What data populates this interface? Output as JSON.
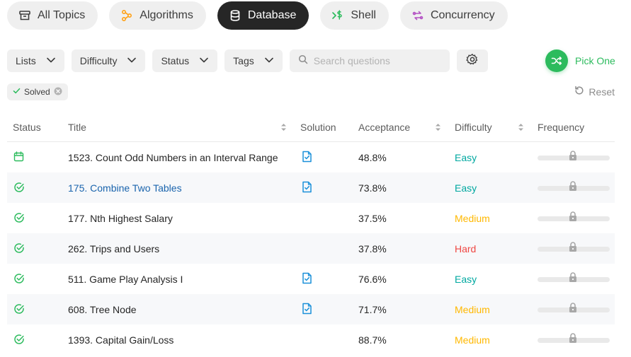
{
  "topics": [
    {
      "label": "All Topics",
      "icon": "archive-icon",
      "active": false
    },
    {
      "label": "Algorithms",
      "icon": "algorithms-icon",
      "active": false
    },
    {
      "label": "Database",
      "icon": "database-icon",
      "active": true
    },
    {
      "label": "Shell",
      "icon": "shell-icon",
      "active": false
    },
    {
      "label": "Concurrency",
      "icon": "concurrency-icon",
      "active": false
    }
  ],
  "filters": {
    "lists": "Lists",
    "difficulty": "Difficulty",
    "status": "Status",
    "tags": "Tags",
    "search_placeholder": "Search questions"
  },
  "pick_one": "Pick One",
  "active_tag": "Solved",
  "reset": "Reset",
  "columns": {
    "status": "Status",
    "title": "Title",
    "solution": "Solution",
    "acceptance": "Acceptance",
    "difficulty": "Difficulty",
    "frequency": "Frequency"
  },
  "rows": [
    {
      "status": "calendar-icon",
      "title": "1523. Count Odd Numbers in an Interval Range",
      "solution": true,
      "acceptance": "48.8%",
      "difficulty": "Easy"
    },
    {
      "status": "check-icon",
      "title": "175. Combine Two Tables",
      "solution": true,
      "acceptance": "73.8%",
      "difficulty": "Easy"
    },
    {
      "status": "check-icon",
      "title": "177. Nth Highest Salary",
      "solution": false,
      "acceptance": "37.5%",
      "difficulty": "Medium"
    },
    {
      "status": "check-icon",
      "title": "262. Trips and Users",
      "solution": false,
      "acceptance": "37.8%",
      "difficulty": "Hard"
    },
    {
      "status": "check-icon",
      "title": "511. Game Play Analysis I",
      "solution": true,
      "acceptance": "76.6%",
      "difficulty": "Easy"
    },
    {
      "status": "check-icon",
      "title": "608. Tree Node",
      "solution": true,
      "acceptance": "71.7%",
      "difficulty": "Medium"
    },
    {
      "status": "check-icon",
      "title": "1393. Capital Gain/Loss",
      "solution": false,
      "acceptance": "88.7%",
      "difficulty": "Medium"
    }
  ],
  "colors": {
    "green": "#2cbb5d",
    "easy": "#00a8a0",
    "medium": "#ffb800",
    "hard": "#ef4743",
    "link": "#1a64ad",
    "solution_icon": "#1a90d9"
  }
}
